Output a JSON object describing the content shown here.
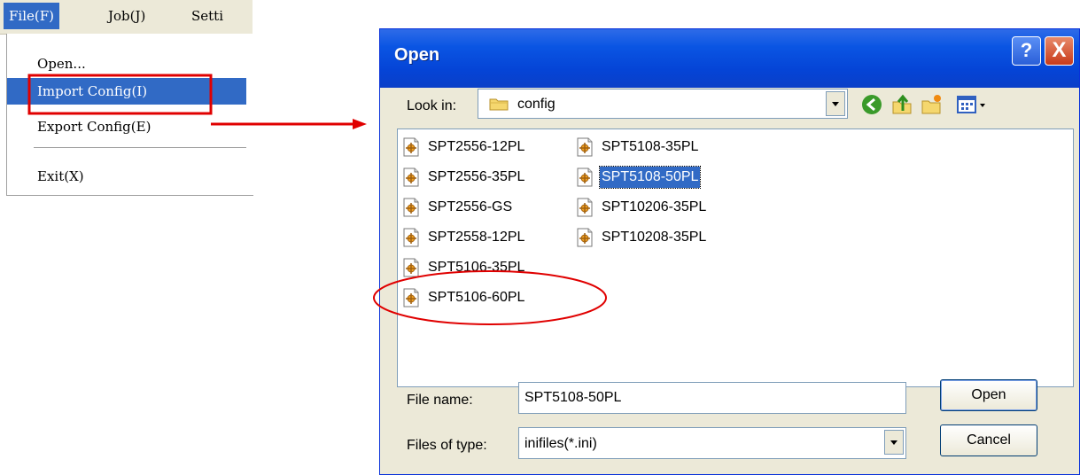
{
  "menubar": {
    "items": [
      {
        "label": "File(F)",
        "active": true
      },
      {
        "label": "Job(J)",
        "active": false
      },
      {
        "label": "Setti",
        "active": false
      }
    ]
  },
  "file_menu": {
    "items": [
      "Open...",
      "Import Config(I)",
      "Export Config(E)",
      "Exit(X)"
    ],
    "highlighted": "Import Config(I)"
  },
  "dialog": {
    "title": "Open",
    "help_button": "?",
    "close_button": "X",
    "look_in_label": "Look in:",
    "look_in_value": "config",
    "toolbar_icons": [
      "back-icon",
      "up-folder-icon",
      "new-folder-icon",
      "view-menu-icon"
    ],
    "files": [
      "SPT2556-12PL",
      "SPT2556-35PL",
      "SPT2556-GS",
      "SPT2558-12PL",
      "SPT5106-35PL",
      "SPT5106-60PL",
      "SPT5108-35PL",
      "SPT5108-50PL",
      "SPT10206-35PL",
      "SPT10208-35PL"
    ],
    "selected_file": "SPT5108-50PL",
    "file_name_label": "File name:",
    "file_name_value": "SPT5108-50PL",
    "files_of_type_label": "Files of type:",
    "files_of_type_value": "inifiles(*.ini)",
    "open_button": "Open",
    "cancel_button": "Cancel"
  },
  "colors": {
    "selection": "#316ac5",
    "titlebar": "#0a55e3",
    "annotation_red": "#e00000",
    "dialog_face": "#ece9d8"
  }
}
